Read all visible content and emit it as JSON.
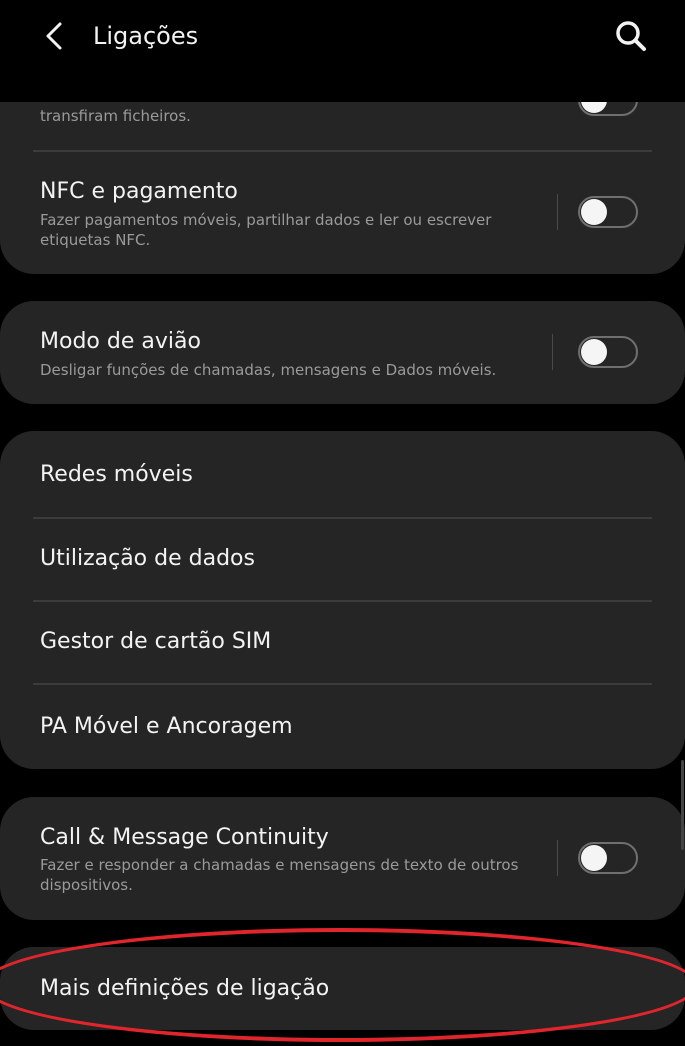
{
  "header": {
    "title": "Ligações",
    "back_icon": "chevron-left-icon",
    "search_icon": "search-icon"
  },
  "cards": {
    "transfer": {
      "partial_subtitle": "transfiram ficheiros."
    },
    "nfc": {
      "title": "NFC e pagamento",
      "subtitle": "Fazer pagamentos móveis, partilhar dados e ler ou escrever etiquetas NFC.",
      "enabled": false
    },
    "airplane": {
      "title": "Modo de avião",
      "subtitle": "Desligar funções de chamadas, mensagens e Dados móveis.",
      "enabled": false
    },
    "network": {
      "items": [
        "Redes móveis",
        "Utilização de dados",
        "Gestor de cartão SIM",
        "PA Móvel e Ancoragem"
      ]
    },
    "continuity": {
      "title": "Call & Message Continuity",
      "subtitle": "Fazer e responder a chamadas e mensagens de texto de outros dispositivos.",
      "enabled": false
    },
    "more": {
      "title": "Mais definições de ligação"
    }
  },
  "colors": {
    "background": "#000000",
    "card": "#252525",
    "highlight": "#e0262c"
  }
}
